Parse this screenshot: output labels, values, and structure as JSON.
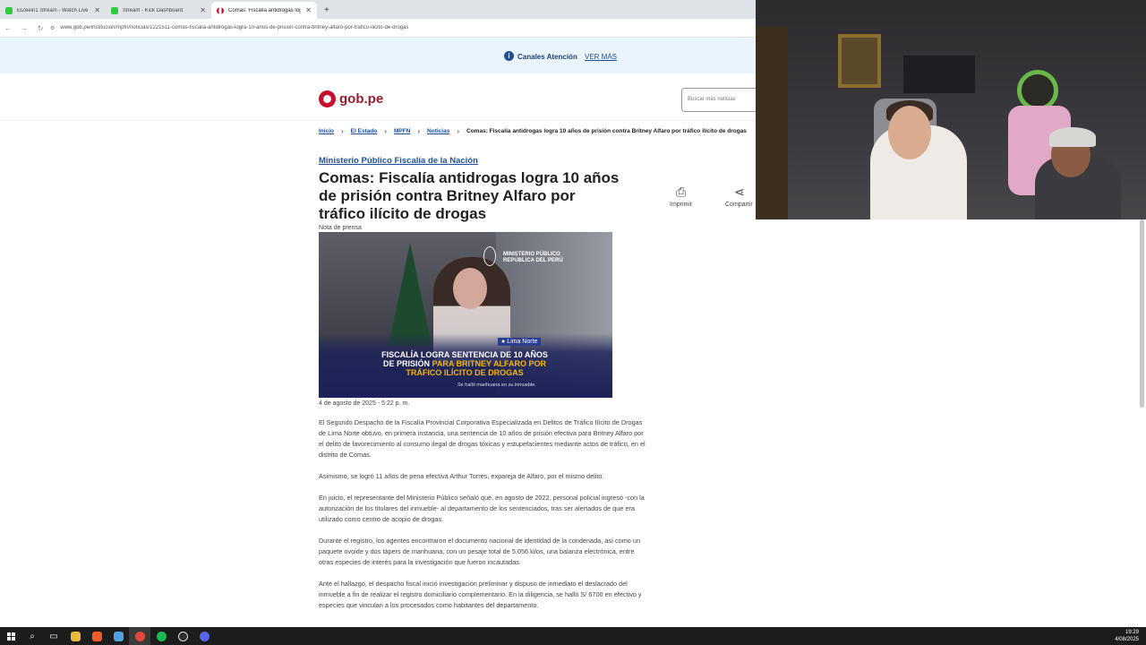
{
  "browser": {
    "tabs": [
      {
        "title": "ElZeein1 Stream - Watch Live o",
        "favicon": "kick-icon",
        "active": false
      },
      {
        "title": "Stream - Kick Dashboard",
        "favicon": "kick-icon",
        "active": false
      },
      {
        "title": "Comas: Fiscalía antidrogas logr",
        "favicon": "peru-flag-icon",
        "active": true
      }
    ],
    "new_tab": "+",
    "url": "www.gob.pe/institucion/mpfn/noticias/1221511-comas-fiscalia-antidrogas-logra-10-anos-de-prision-contra-britney-alfaro-por-trafico-ilicito-de-drogas"
  },
  "site": {
    "banner": {
      "canales": "Canales Atención",
      "ver_mas": "VER MÁS"
    },
    "logo_text": "gob.pe",
    "search_placeholder": "Buscar más noticias"
  },
  "breadcrumb": {
    "items": [
      "Inicio",
      "El Estado",
      "MPFN",
      "Noticias"
    ],
    "current": "Comas: Fiscalía antidrogas logra 10 años de prisión contra Britney Alfaro por tráfico ilícito de drogas"
  },
  "article": {
    "category": "Ministerio Público Fiscalía de la Nación",
    "title": "Comas: Fiscalía antidrogas logra 10 años de prisión contra Britney Alfaro por tráfico ilícito de drogas",
    "kind": "Nota de prensa",
    "image": {
      "org_line1": "MINISTERIO PÚBLICO",
      "org_line2": "REPÚBLICA DEL PERÚ",
      "location": "Lima Norte",
      "headline_part1": "FISCALÍA LOGRA SENTENCIA DE 10 AÑOS DE PRISIÓN ",
      "headline_part2": "PARA BRITNEY ALFARO POR TRÁFICO ILÍCITO DE DROGAS",
      "subline": "Se halló marihuana en su inmueble."
    },
    "date": "4 de agosto de 2025 - 5:22 p. m.",
    "paragraphs": [
      "El Segundo Despacho de la Fiscalía Provincial Corporativa Especializada en Delitos de Tráfico Ilícito de Drogas de Lima Norte obtuvo, en primera instancia, una sentencia de 10 años de prisión efectiva para Britney Alfaro por el delito de favorecimiento al consumo ilegal de drogas tóxicas y estupefacientes mediante actos de tráfico, en el distrito de Comas.",
      "Asimismo, se logró 11 años de pena efectiva Arthur Torres, expareja de Alfaro, por el mismo delito.",
      "En juicio, el representante del Ministerio Público señaló que, en agosto de 2022, personal policial ingresó -con la autorización de los titulares del inmueble- al departamento de los sentenciados, tras ser alertados de que era utilizado como centro de acopio de drogas.",
      "Durante el registro, los agentes encontraron el documento nacional de identidad de la condenada, así como un paquete ovoide y dos tápers de marihuana, con un pesaje total de 5.056 kilos, una balanza electrónica, entre otras especies de interés para la investigación que fueron incautadas.",
      "Ante el hallazgo, el despacho fiscal inició investigación preliminar y dispuso de inmediato el deslacrado del inmueble a fin de realizar el registro domiciliario complementario. En la diligencia, se halló S/ 6700 en efectivo y especies que vinculan a los procesados como habitantes del departamento."
    ],
    "actions": {
      "print": "Imprimir",
      "share": "Compartir"
    }
  },
  "taskbar": {
    "time": "19:29",
    "date": "4/08/2025"
  },
  "colors": {
    "accent_blue": "#1f4e9c",
    "brand_red": "#9b1c2c",
    "banner_bg": "#eaf4fc"
  }
}
